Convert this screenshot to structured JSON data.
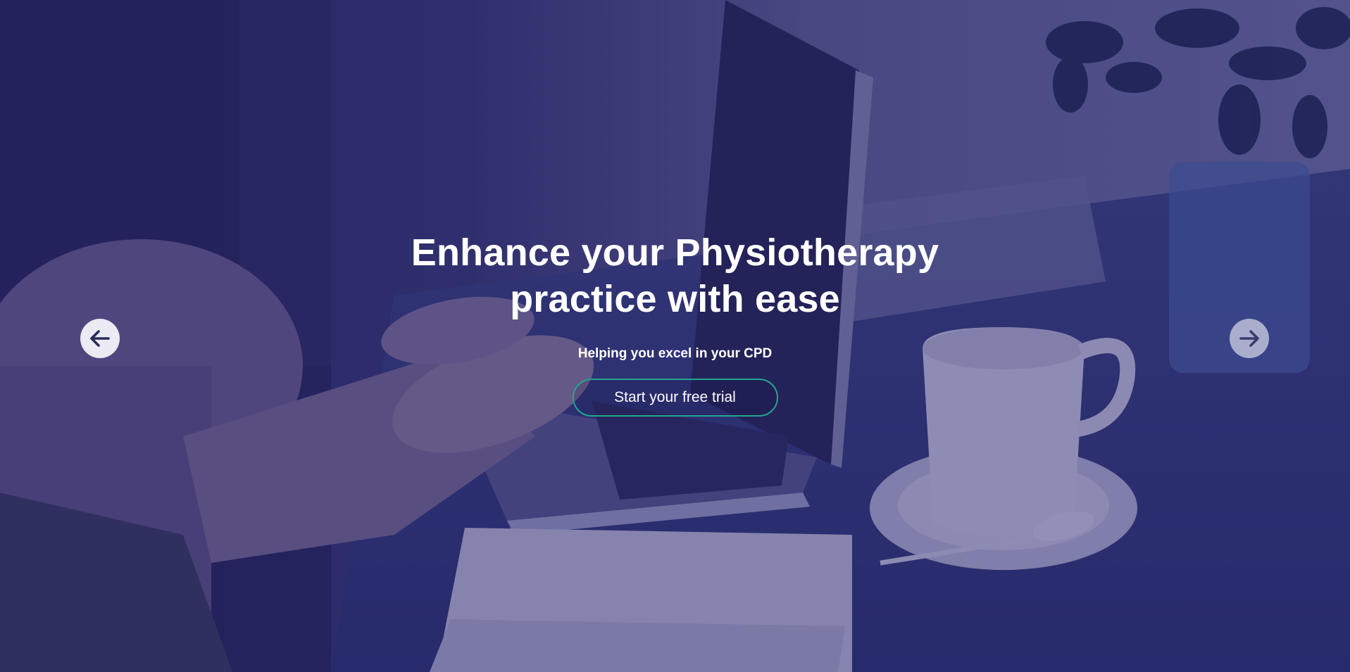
{
  "hero": {
    "headline_line1": "Enhance your Physiotherapy",
    "headline_line2": "practice with ease",
    "subtitle": "Helping you excel in your CPD",
    "cta_label": "Start your free trial"
  },
  "carousel": {
    "prev_icon": "arrow-left-icon",
    "next_icon": "arrow-right-icon"
  },
  "colors": {
    "overlay": "#2b2a6e",
    "cta_border": "#24a58d",
    "text": "#ffffff",
    "arrow_bg": "#ecebf3",
    "arrow_fg": "#2a2a5e"
  }
}
